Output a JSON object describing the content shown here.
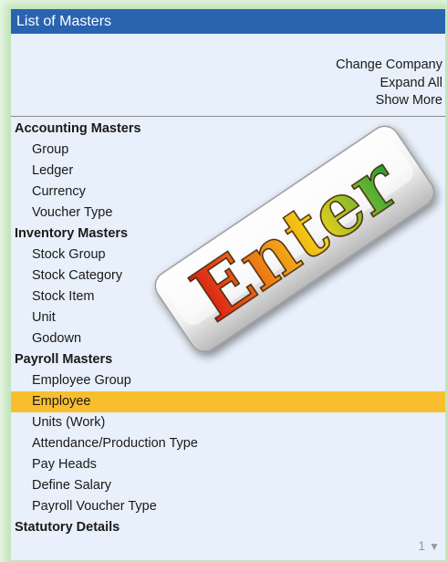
{
  "window": {
    "title": "List of Masters"
  },
  "top_links": [
    "Change Company",
    "Expand All",
    "Show More"
  ],
  "sections": [
    {
      "heading": "Accounting Masters",
      "items": [
        "Group",
        "Ledger",
        "Currency",
        "Voucher Type"
      ]
    },
    {
      "heading": "Inventory Masters",
      "items": [
        "Stock Group",
        "Stock Category",
        "Stock Item",
        "Unit",
        "Godown"
      ]
    },
    {
      "heading": "Payroll Masters",
      "items": [
        "Employee Group",
        "Employee",
        "Units (Work)",
        "Attendance/Production Type",
        "Pay Heads",
        "Define Salary",
        "Payroll Voucher Type"
      ]
    },
    {
      "heading": "Statutory Details",
      "items": []
    }
  ],
  "selected_item": "Employee",
  "overlay": {
    "text": "Enter"
  },
  "page_indicator": {
    "page": "1",
    "arrow_icon": "down-triangle-icon"
  },
  "colors": {
    "title_bar": "#2a63b0",
    "panel_background": "#e8f0fb",
    "selection": "#f9be2e",
    "outer_glow": "#96d28c"
  }
}
